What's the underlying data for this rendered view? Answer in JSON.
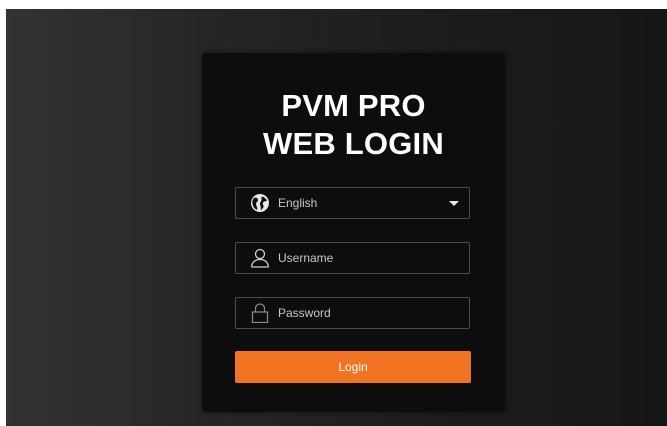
{
  "page": {
    "title_line1": "PVM PRO",
    "title_line2": "WEB LOGIN"
  },
  "language": {
    "selected": "English",
    "icon": "globe-icon",
    "dropdown_icon": "caret-down-icon"
  },
  "username": {
    "placeholder": "Username",
    "icon": "user-icon"
  },
  "password": {
    "placeholder": "Password",
    "icon": "lock-icon"
  },
  "login": {
    "label": "Login",
    "color": "#f07421"
  },
  "colors": {
    "panel_background": "#0d0d0d",
    "field_border": "#4d4d4d",
    "text": "#ffffff"
  }
}
